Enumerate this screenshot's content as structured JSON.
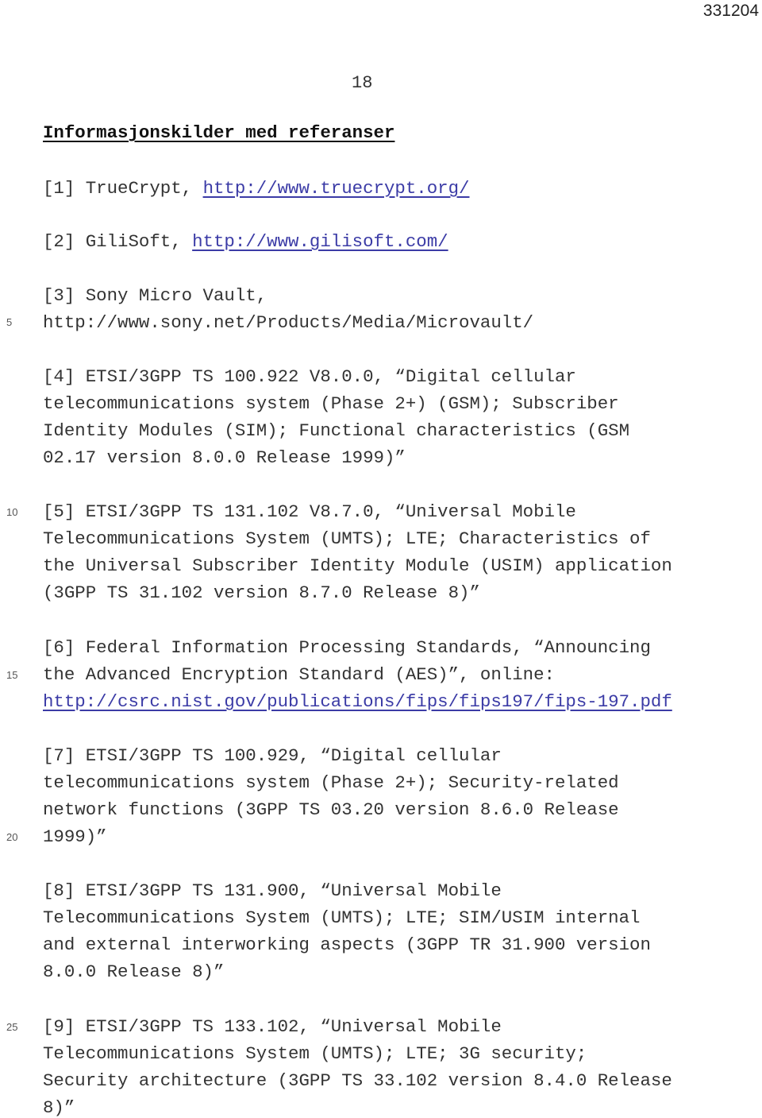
{
  "doc_number": "331204",
  "page_number": "18",
  "heading": "Informasjonskilder med referanser",
  "line_numbers": [
    "5",
    "10",
    "15",
    "20",
    "25"
  ],
  "references": [
    {
      "lines": [
        {
          "text": "[1] TrueCrypt, ",
          "link": "http://www.truecrypt.org/"
        }
      ]
    },
    {
      "lines": [
        {
          "text": "[2] GiliSoft, ",
          "link": "http://www.gilisoft.com/"
        }
      ]
    },
    {
      "lines": [
        {
          "text": "[3] Sony Micro Vault,"
        },
        {
          "text": "http://www.sony.net/Products/Media/Microvault/"
        }
      ]
    },
    {
      "lines": [
        {
          "text": "[4] ETSI/3GPP TS 100.922 V8.0.0, “Digital cellular"
        },
        {
          "text": "telecommunications system (Phase 2+) (GSM); Subscriber"
        },
        {
          "text": "Identity Modules (SIM); Functional characteristics (GSM"
        },
        {
          "text": "02.17 version 8.0.0 Release 1999)”"
        }
      ]
    },
    {
      "lines": [
        {
          "text": "[5] ETSI/3GPP TS 131.102 V8.7.0, “Universal Mobile"
        },
        {
          "text": "Telecommunications System (UMTS); LTE; Characteristics of"
        },
        {
          "text": "the Universal Subscriber Identity Module (USIM) application"
        },
        {
          "text": "(3GPP TS 31.102 version 8.7.0 Release 8)”"
        }
      ]
    },
    {
      "lines": [
        {
          "text": "[6] Federal Information Processing Standards, “Announcing"
        },
        {
          "text": "the Advanced Encryption Standard (AES)”, online:"
        },
        {
          "text": "",
          "link": "http://csrc.nist.gov/publications/fips/fips197/fips-197.pdf"
        }
      ]
    },
    {
      "lines": [
        {
          "text": "[7] ETSI/3GPP TS 100.929, “Digital cellular"
        },
        {
          "text": "telecommunications system (Phase 2+); Security-related"
        },
        {
          "text": "network functions (3GPP TS 03.20 version 8.6.0 Release"
        },
        {
          "text": "1999)”"
        }
      ]
    },
    {
      "lines": [
        {
          "text": "[8] ETSI/3GPP TS 131.900, “Universal Mobile"
        },
        {
          "text": "Telecommunications System (UMTS); LTE; SIM/USIM internal"
        },
        {
          "text": "and external interworking aspects (3GPP TR 31.900 version"
        },
        {
          "text": "8.0.0 Release 8)”"
        }
      ]
    },
    {
      "lines": [
        {
          "text": "[9] ETSI/3GPP TS 133.102, “Universal Mobile"
        },
        {
          "text": "Telecommunications System (UMTS); LTE; 3G security;"
        },
        {
          "text": "Security architecture (3GPP TS 33.102 version 8.4.0 Release"
        },
        {
          "text": "8)”"
        }
      ]
    }
  ]
}
